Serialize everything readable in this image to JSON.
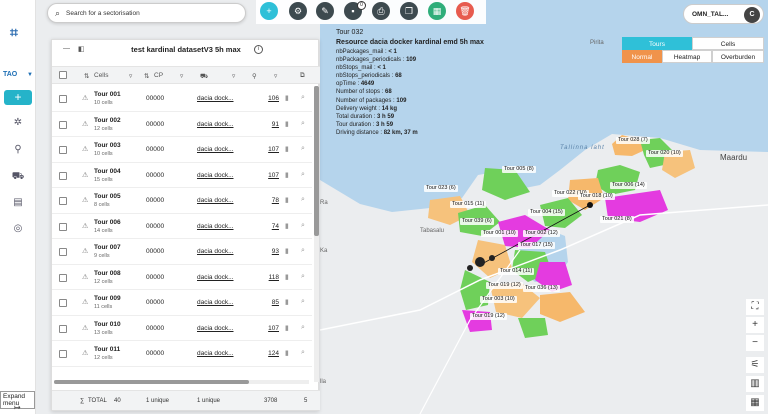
{
  "search": {
    "placeholder": "Search for a sectorisation"
  },
  "toolbar": {
    "badge": "0"
  },
  "user": {
    "name": "OMN_TAL...",
    "avatar": "C"
  },
  "sidebar": {
    "project": "TAO",
    "expand_label": "Expand menu"
  },
  "panel": {
    "title": "test kardinal datasetV3 5h max",
    "columns": {
      "cells": "Cells",
      "cp": "CP"
    },
    "rows": [
      {
        "name": "Tour 001",
        "cells": "10 cells",
        "cp": "00000",
        "resource": "dacia dock...",
        "value": "106"
      },
      {
        "name": "Tour 002",
        "cells": "12 cells",
        "cp": "00000",
        "resource": "dacia dock...",
        "value": "91"
      },
      {
        "name": "Tour 003",
        "cells": "10 cells",
        "cp": "00000",
        "resource": "dacia dock...",
        "value": "107"
      },
      {
        "name": "Tour 004",
        "cells": "15 cells",
        "cp": "00000",
        "resource": "dacia dock...",
        "value": "107"
      },
      {
        "name": "Tour 005",
        "cells": "8 cells",
        "cp": "00000",
        "resource": "dacia dock...",
        "value": "78"
      },
      {
        "name": "Tour 006",
        "cells": "14 cells",
        "cp": "00000",
        "resource": "dacia dock...",
        "value": "74"
      },
      {
        "name": "Tour 007",
        "cells": "9 cells",
        "cp": "00000",
        "resource": "dacia dock...",
        "value": "93"
      },
      {
        "name": "Tour 008",
        "cells": "12 cells",
        "cp": "00000",
        "resource": "dacia dock...",
        "value": "118"
      },
      {
        "name": "Tour 009",
        "cells": "11 cells",
        "cp": "00000",
        "resource": "dacia dock...",
        "value": "85"
      },
      {
        "name": "Tour 010",
        "cells": "13 cells",
        "cp": "00000",
        "resource": "dacia dock...",
        "value": "107"
      },
      {
        "name": "Tour 011",
        "cells": "12 cells",
        "cp": "00000",
        "resource": "dacia dock...",
        "value": "124"
      }
    ],
    "footer": {
      "total_label": "TOTAL",
      "total_value": "40",
      "cp_unique": "1 unique",
      "res_unique": "1 unique",
      "sum": "3708",
      "sum2": "5"
    }
  },
  "info": {
    "tour": "Tour 032",
    "resource": "Resource dacia docker kardinal emd 5h max",
    "lines": [
      {
        "k": "nbPackages_mail",
        "v": "< 1"
      },
      {
        "k": "nbPackages_periodicals",
        "v": "109"
      },
      {
        "k": "nbStops_mail",
        "v": "< 1"
      },
      {
        "k": "nbStops_periodicals",
        "v": "68"
      },
      {
        "k": "opTime",
        "v": "4649"
      },
      {
        "k": "Number of stops",
        "v": "68"
      },
      {
        "k": "Number of packages",
        "v": "109"
      },
      {
        "k": "Delivery weight",
        "v": "14 kg"
      },
      {
        "k": "Total duration",
        "v": "3 h 59"
      },
      {
        "k": "Tour duration",
        "v": "3 h 59"
      },
      {
        "k": "Driving distance",
        "v": "82 km, 37 m"
      }
    ]
  },
  "toggle": {
    "tours": "Tours",
    "cells": "Cells",
    "normal": "Normal",
    "heatmap": "Heatmap",
    "overburden": "Overburden"
  },
  "map": {
    "labels": {
      "bay": "Tallinna laht",
      "tabasalu": "Tabasalu",
      "maardu": "Maardu",
      "paljassaare": "Paljassaare",
      "pirita": "Pirita",
      "ra": "Ra",
      "ka": "Ka",
      "lla": "lla"
    },
    "tours": [
      {
        "label": "Tour 028 (7)"
      },
      {
        "label": "Tour 020 (10)"
      },
      {
        "label": "Tour 005 (8)"
      },
      {
        "label": "Tour 022 (10)"
      },
      {
        "label": "Tour 018 (10)"
      },
      {
        "label": "Tour 006 (14)"
      },
      {
        "label": "Tour 023 (6)"
      },
      {
        "label": "Tour 015 (11)"
      },
      {
        "label": "Tour 004 (15)"
      },
      {
        "label": "Tour 021 (8)"
      },
      {
        "label": "Tour 039 (6)"
      },
      {
        "label": "Tour 001 (10)"
      },
      {
        "label": "Tour 002 (12)"
      },
      {
        "label": "Tour 017 (15)"
      },
      {
        "label": "Tour 014 (11)"
      },
      {
        "label": "Tour 019 (12)"
      },
      {
        "label": "Tour 036 (13)"
      },
      {
        "label": "Tour 003 (10)"
      },
      {
        "label": "Tour 019 (12)"
      }
    ]
  },
  "colors": {
    "accent": "#25b3c9",
    "tours": "#2fc0d8",
    "normal": "#f0934b"
  }
}
